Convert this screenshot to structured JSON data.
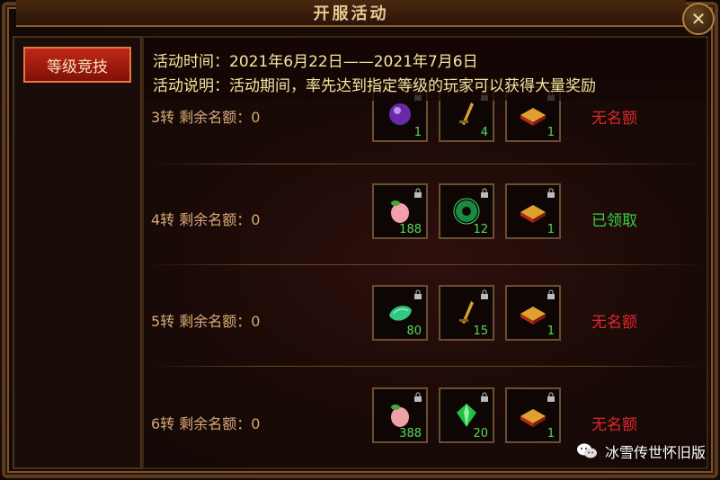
{
  "window": {
    "title": "开服活动",
    "close_glyph": "✕"
  },
  "sidebar": {
    "tabs": [
      {
        "label": "等级竞技"
      }
    ]
  },
  "info": {
    "time": "活动时间：2021年6月22日——2021年7月6日",
    "desc": "活动说明：活动期间，率先达到指定等级的玩家可以获得大量奖励"
  },
  "rows": [
    {
      "label": "3转  剩余名额：0",
      "status": "无名额",
      "status_color": "red",
      "items": [
        {
          "icon": "purple-orb-icon",
          "count": "1"
        },
        {
          "icon": "gold-sword-icon",
          "count": "4"
        },
        {
          "icon": "gold-book-icon",
          "count": "1"
        }
      ]
    },
    {
      "label": "4转  剩余名额：0",
      "status": "已领取",
      "status_color": "green",
      "items": [
        {
          "icon": "peach-icon",
          "count": "188"
        },
        {
          "icon": "jade-ring-icon",
          "count": "12"
        },
        {
          "icon": "gold-book-icon",
          "count": "1"
        }
      ]
    },
    {
      "label": "5转  剩余名额：0",
      "status": "无名额",
      "status_color": "red",
      "items": [
        {
          "icon": "jade-crystal-icon",
          "count": "80"
        },
        {
          "icon": "gold-sword-icon",
          "count": "15"
        },
        {
          "icon": "gold-book-icon",
          "count": "1"
        }
      ]
    },
    {
      "label": "6转  剩余名额：0",
      "status": "无名额",
      "status_color": "red",
      "items": [
        {
          "icon": "peach-icon",
          "count": "388"
        },
        {
          "icon": "green-gem-icon",
          "count": "20"
        },
        {
          "icon": "gold-book-icon",
          "count": "1"
        }
      ]
    }
  ],
  "watermark": {
    "text": "冰雪传世怀旧版"
  }
}
